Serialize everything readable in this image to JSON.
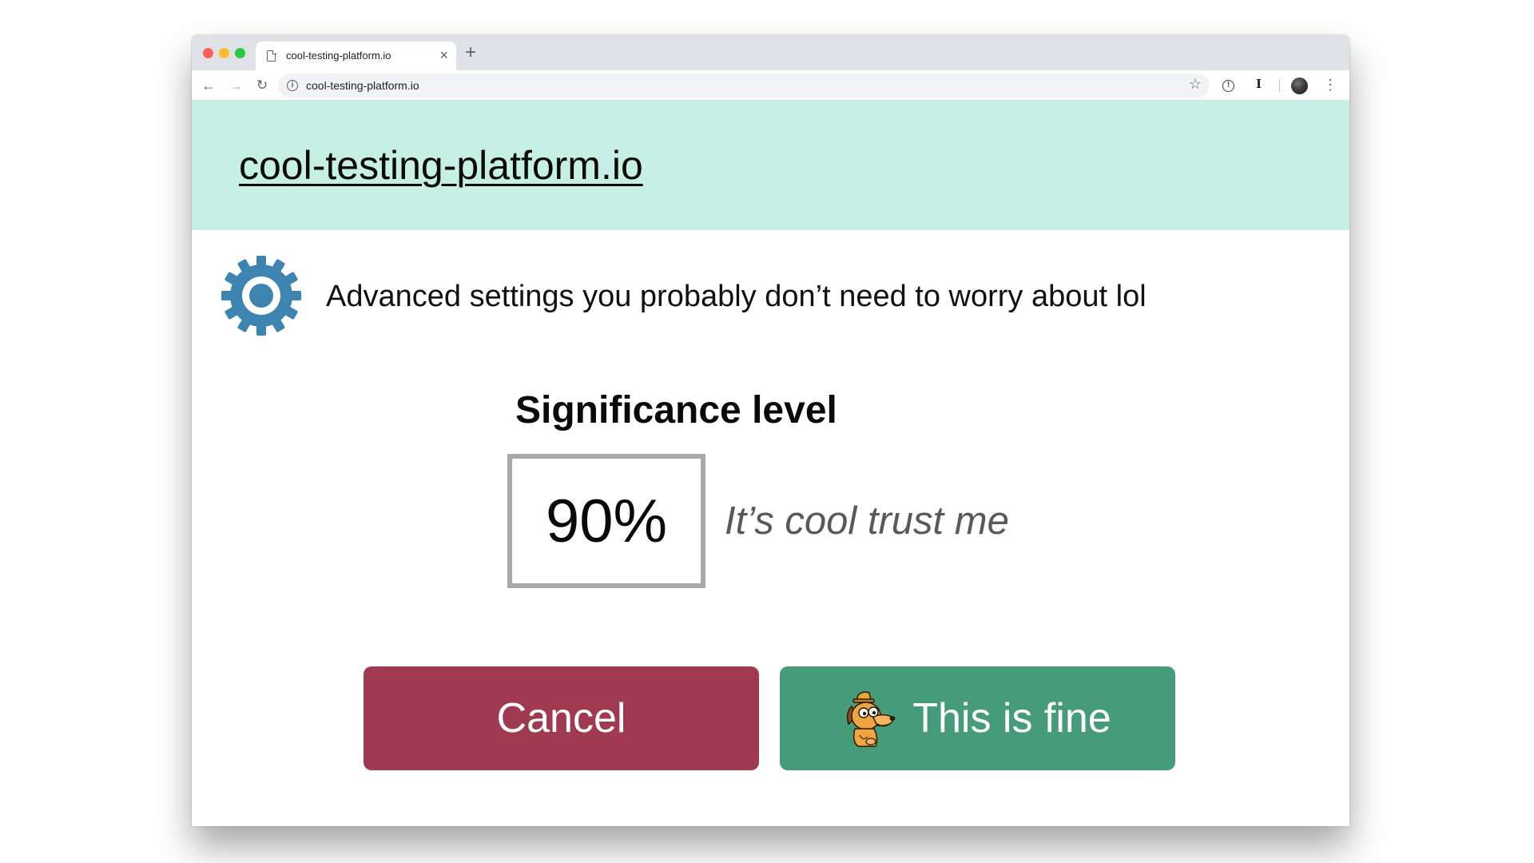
{
  "colors": {
    "header_bg": "#c6f0e3",
    "gear": "#3e84b0",
    "cancel_bg": "#a03a50",
    "fine_bg": "#469c79",
    "traffic_red": "#fd5f57",
    "traffic_yellow": "#febc2e",
    "traffic_green": "#28c840"
  },
  "browser": {
    "tab_title": "cool-testing-platform.io",
    "tab_close": "×",
    "new_tab": "+",
    "url": "cool-testing-platform.io",
    "icons": {
      "back": "arrow-left",
      "forward": "arrow-right",
      "reload": "reload",
      "site_info": "info",
      "bookmark": "star",
      "extension_1": "info",
      "extension_2": "I",
      "menu": "vertical-dots"
    }
  },
  "header": {
    "site_title": "cool-testing-platform.io"
  },
  "settings": {
    "icon": "gear",
    "heading": "Advanced settings you probably don’t need to worry about lol"
  },
  "significance": {
    "label": "Significance level",
    "value": "90%",
    "note": "It’s cool trust me"
  },
  "actions": {
    "cancel_label": "Cancel",
    "confirm_label": "This is fine",
    "confirm_icon": "this-is-fine-dog"
  }
}
